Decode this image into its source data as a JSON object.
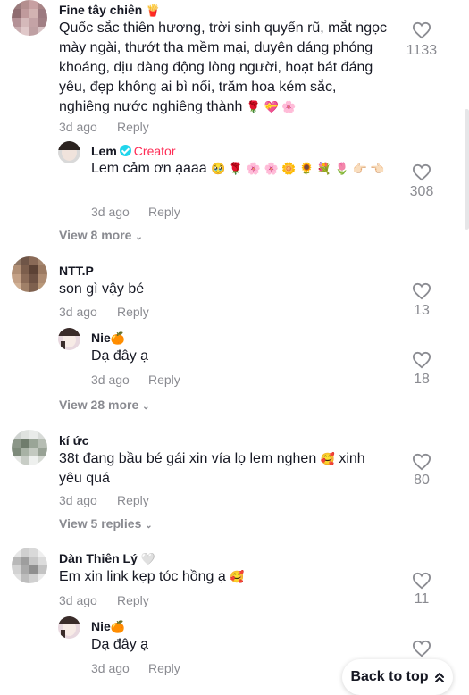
{
  "comments": [
    {
      "username": "Fine tây chiên",
      "username_emoji": "🍟",
      "text": "Quốc sắc thiên hương, trời sinh quyến rũ, mắt ngọc mày ngài, thướt tha mềm mại, duyên dáng phóng khoáng, dịu dàng động lòng người, hoạt bát đáng yêu, đẹp không ai bì nổi, trăm hoa kém sắc, nghiêng nước nghiêng thành",
      "text_emoji": "🌹 💝 🌸",
      "time": "3d ago",
      "reply_label": "Reply",
      "likes": "1133",
      "reply": {
        "username": "Lem",
        "creator_label": "Creator",
        "text": "Lem cảm ơn ạaaa",
        "text_emoji": "🥹 🌹 🌸 🌸 🌼 🌻 💐 🌷 👉🏻 👈🏻",
        "time": "3d ago",
        "reply_label": "Reply",
        "likes": "308"
      },
      "view_more": "View 8 more"
    },
    {
      "username": "NTT.P",
      "text": "son gì vậy bé",
      "time": "3d ago",
      "reply_label": "Reply",
      "likes": "13",
      "reply": {
        "username": "Nie",
        "username_emoji": "🍊",
        "text": "Dạ đây ạ",
        "time": "3d ago",
        "reply_label": "Reply",
        "likes": "18"
      },
      "view_more": "View 28 more"
    },
    {
      "username": "kí ức",
      "text": "38t đang bầu bé gái xin vía lọ lem nghen",
      "text_emoji": "🥰",
      "text_after": "xinh yêu quá",
      "time": "3d ago",
      "reply_label": "Reply",
      "likes": "80",
      "view_more": "View 5 replies"
    },
    {
      "username": "Dàn Thiên Lý",
      "username_emoji": "🤍",
      "text": "Em xin link kẹp tóc hồng ạ",
      "text_emoji": "🥰",
      "time": "3d ago",
      "reply_label": "Reply",
      "likes": "11",
      "reply": {
        "username": "Nie",
        "username_emoji": "🍊",
        "text": "Dạ đây ạ",
        "time": "3d ago",
        "reply_label": "Reply"
      }
    }
  ],
  "back_to_top": "Back to top",
  "colors": {
    "accent": "#fe2c55",
    "muted": "#8a8b91",
    "text": "#161823",
    "verified": "#20d5ec"
  }
}
